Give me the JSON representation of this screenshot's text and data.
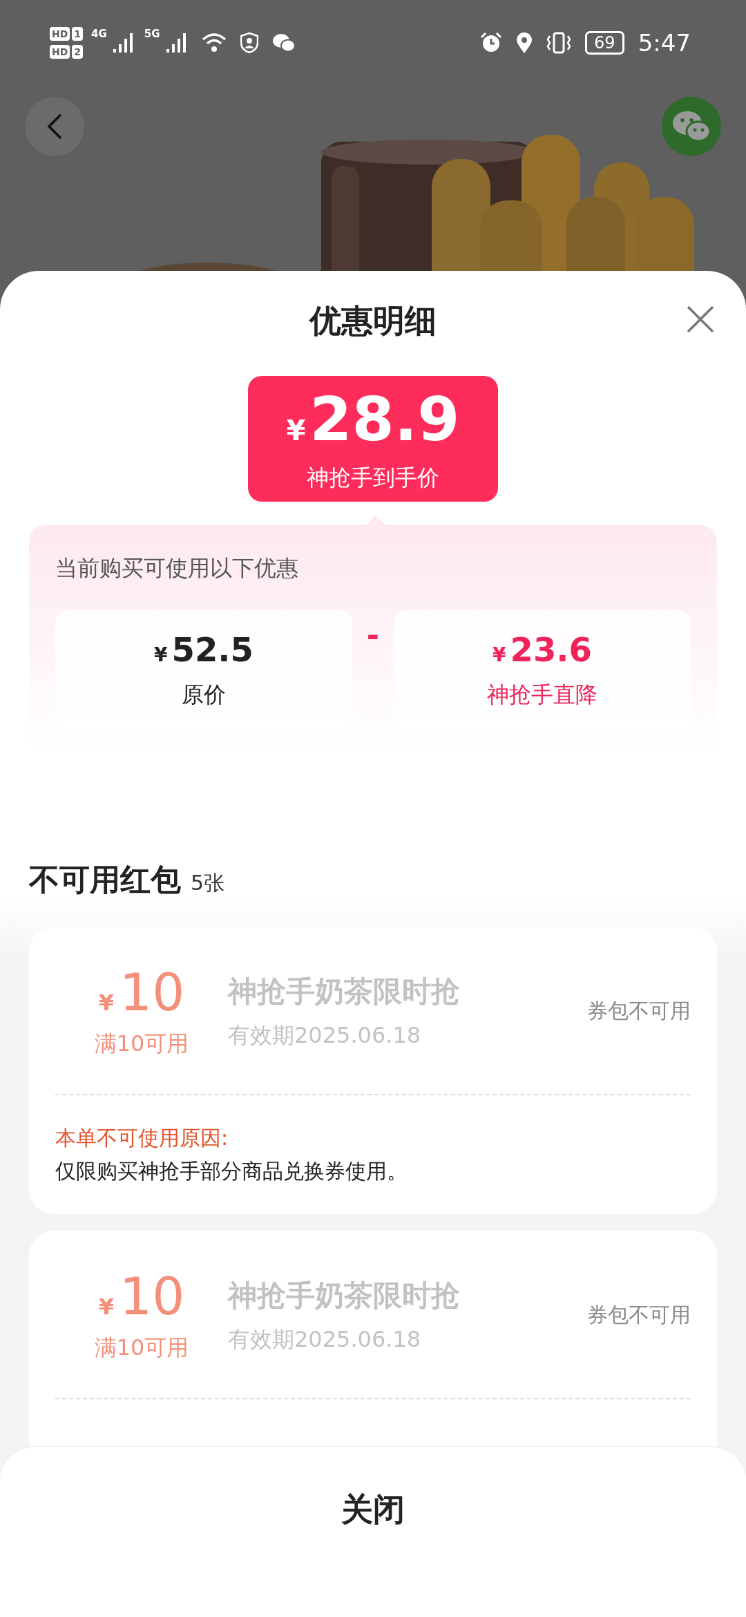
{
  "status_bar": {
    "sims": [
      {
        "label": "HD",
        "slot": "1"
      },
      {
        "label": "HD",
        "slot": "2"
      }
    ],
    "networks": [
      "4G",
      "5G"
    ],
    "battery": "69",
    "time": "5:47"
  },
  "sheet": {
    "title": "优惠明细",
    "final_price": {
      "currency": "¥",
      "amount": "28.9",
      "label": "神抢手到手价"
    },
    "offers": {
      "heading": "当前购买可使用以下优惠",
      "operator": "-",
      "items": [
        {
          "kind": "original",
          "currency": "¥",
          "amount": "52.5",
          "label": "原价"
        },
        {
          "kind": "discount",
          "currency": "¥",
          "amount": "23.6",
          "label": "神抢手直降"
        }
      ]
    },
    "unavailable": {
      "title": "不可用红包",
      "count": "5张",
      "coupons": [
        {
          "currency": "¥",
          "amount": "10",
          "threshold": "满10可用",
          "name": "神抢手奶茶限时抢",
          "expiry": "有效期2025.06.18",
          "status": "券包不可用",
          "reason_label": "本单不可使用原因:",
          "reason": "仅限购买神抢手部分商品兑换券使用。"
        },
        {
          "currency": "¥",
          "amount": "10",
          "threshold": "满10可用",
          "name": "神抢手奶茶限时抢",
          "expiry": "有效期2025.06.18",
          "status": "券包不可用"
        }
      ]
    }
  },
  "footer": {
    "button": "关闭"
  }
}
